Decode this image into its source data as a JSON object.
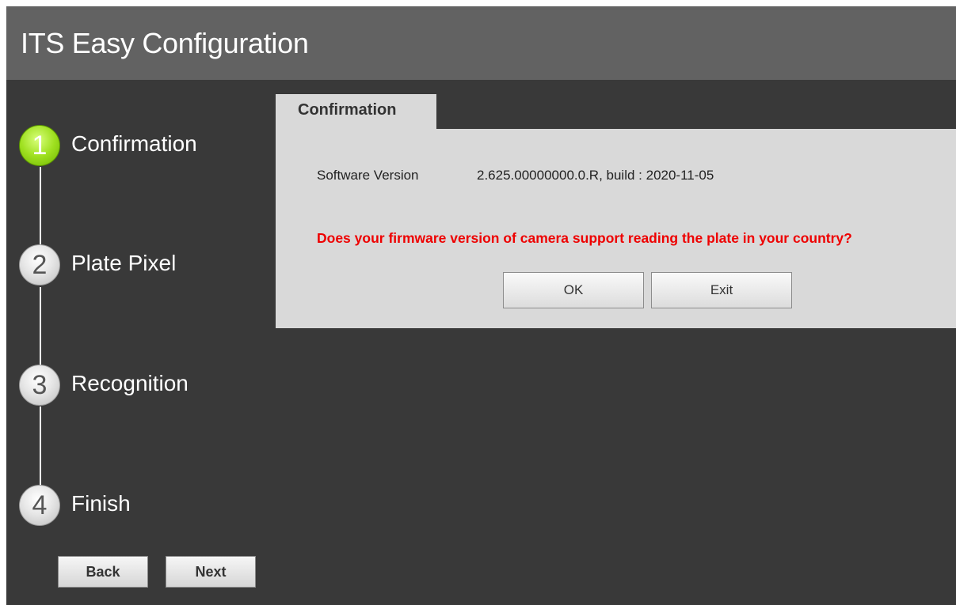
{
  "window": {
    "title": "ITS Easy Configuration"
  },
  "steps": [
    {
      "number": "1",
      "label": "Confirmation",
      "state": "active"
    },
    {
      "number": "2",
      "label": "Plate Pixel",
      "state": "inactive"
    },
    {
      "number": "3",
      "label": "Recognition",
      "state": "inactive"
    },
    {
      "number": "4",
      "label": "Finish",
      "state": "inactive"
    }
  ],
  "nav": {
    "back_label": "Back",
    "next_label": "Next"
  },
  "panel": {
    "tab_label": "Confirmation",
    "software_version_label": "Software Version",
    "software_version_value": "2.625.00000000.0.R, build : 2020-11-05",
    "question": "Does your firmware version of camera support reading the plate in your country?",
    "ok_label": "OK",
    "exit_label": "Exit"
  },
  "colors": {
    "background": "#393939",
    "titlebar": "#626262",
    "panel": "#d9d9d9",
    "active_step": "#8fd11a",
    "question_text": "#ee0000"
  }
}
